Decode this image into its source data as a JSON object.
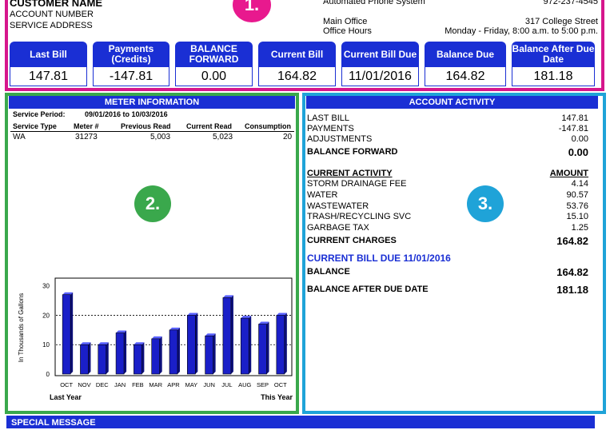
{
  "header": {
    "customer_name": "CUSTOMER NAME",
    "account_number_label": "ACCOUNT NUMBER",
    "service_address_label": "SERVICE ADDRESS",
    "phone_label": "Automated Phone System",
    "phone": "972-237-4545",
    "office_label": "Main Office",
    "office_address": "317 College Street",
    "hours_label": "Office Hours",
    "hours": "Monday - Friday, 8:00 a.m. to 5:00 p.m."
  },
  "badges": {
    "one": "1.",
    "two": "2.",
    "three": "3."
  },
  "colors": {
    "accent_blue": "#1a2fd4",
    "section1": "#d6168c",
    "section2": "#3aa84c",
    "section3": "#1fa3d8",
    "badge1": "#e8198e",
    "badge2": "#3aa84c",
    "badge3": "#1fa3d8"
  },
  "summary": [
    {
      "label": "Last Bill",
      "value": "147.81"
    },
    {
      "label": "Payments (Credits)",
      "value": "-147.81"
    },
    {
      "label": "BALANCE FORWARD",
      "value": "0.00"
    },
    {
      "label": "Current Bill",
      "value": "164.82"
    },
    {
      "label": "Current Bill Due",
      "value": "11/01/2016"
    },
    {
      "label": "Balance Due",
      "value": "164.82"
    },
    {
      "label": "Balance After Due Date",
      "value": "181.18"
    }
  ],
  "meter": {
    "title": "METER INFORMATION",
    "service_period_label": "Service Period:",
    "service_period": "09/01/2016 to 10/03/2016",
    "columns": [
      "Service Type",
      "Meter #",
      "Previous Read",
      "Current Read",
      "Consumption"
    ],
    "row": [
      "WA",
      "31273",
      "5,003",
      "5,023",
      "20"
    ]
  },
  "chart_data": {
    "type": "bar",
    "categories": [
      "OCT",
      "NOV",
      "DEC",
      "JAN",
      "FEB",
      "MAR",
      "APR",
      "MAY",
      "JUN",
      "JUL",
      "AUG",
      "SEP",
      "OCT"
    ],
    "values": [
      27,
      10,
      10,
      14,
      10,
      12,
      15,
      20,
      13,
      26,
      19,
      17,
      20
    ],
    "ylabel": "In Thousands of Gallons",
    "yticks": [
      0,
      10,
      20,
      30
    ],
    "ylim": [
      0,
      31
    ],
    "grid": "dashed at 10 and 20",
    "left_caption": "Last Year",
    "right_caption": "This Year",
    "bar_color": "#1a1fc8"
  },
  "activity": {
    "title": "ACCOUNT ACTIVITY",
    "summary_rows": [
      {
        "label": "LAST BILL",
        "value": "147.81"
      },
      {
        "label": "PAYMENTS",
        "value": "-147.81"
      },
      {
        "label": "ADJUSTMENTS",
        "value": "0.00"
      }
    ],
    "balance_forward_label": "BALANCE FORWARD",
    "balance_forward": "0.00",
    "current_activity_label": "CURRENT ACTIVITY",
    "amount_label": "AMOUNT",
    "charges": [
      {
        "label": "STORM DRAINAGE FEE",
        "value": "4.14"
      },
      {
        "label": "WATER",
        "value": "90.57"
      },
      {
        "label": "WASTEWATER",
        "value": "53.76"
      },
      {
        "label": "TRASH/RECYCLING SVC",
        "value": "15.10"
      },
      {
        "label": "GARBAGE TAX",
        "value": "1.25"
      }
    ],
    "current_charges_label": "CURRENT CHARGES",
    "current_charges": "164.82",
    "current_bill_due_label": "CURRENT BILL DUE 11/01/2016",
    "balance_label": "BALANCE",
    "balance": "164.82",
    "after_due_label": "BALANCE AFTER DUE DATE",
    "after_due": "181.18"
  },
  "special_message": "SPECIAL MESSAGE"
}
